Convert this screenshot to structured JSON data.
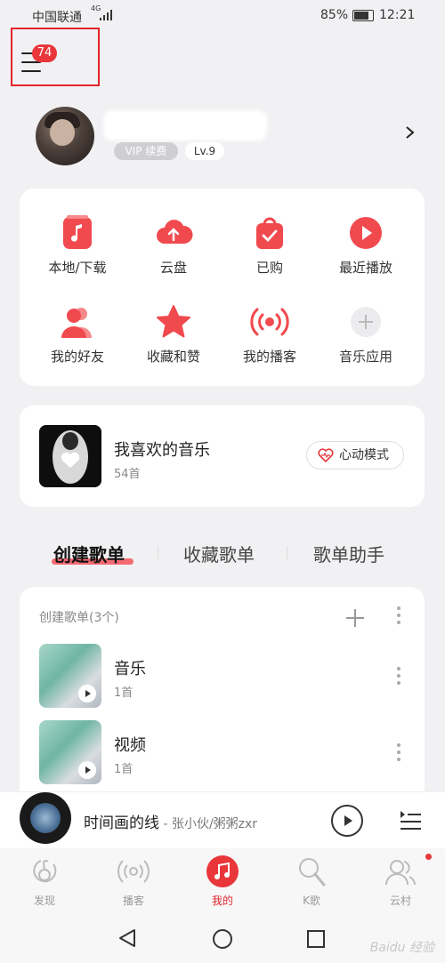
{
  "status_bar": {
    "carrier": "中国联通",
    "network": "4G",
    "battery_pct": "85%",
    "time": "12:21"
  },
  "menu": {
    "badge": "74"
  },
  "profile": {
    "vip_label": "VIP 续费",
    "level": "Lv.9"
  },
  "quick_grid": {
    "items": [
      {
        "label": "本地/下载",
        "icon": "music-note-icon"
      },
      {
        "label": "云盘",
        "icon": "cloud-upload-icon"
      },
      {
        "label": "已购",
        "icon": "shopping-bag-icon"
      },
      {
        "label": "最近播放",
        "icon": "play-circle-icon"
      },
      {
        "label": "我的好友",
        "icon": "friends-icon"
      },
      {
        "label": "收藏和赞",
        "icon": "star-icon"
      },
      {
        "label": "我的播客",
        "icon": "broadcast-icon"
      },
      {
        "label": "音乐应用",
        "icon": "plus-icon"
      }
    ]
  },
  "favorites": {
    "title": "我喜欢的音乐",
    "count": "54首",
    "heart_mode_label": "心动模式"
  },
  "tabs": [
    {
      "label": "创建歌单"
    },
    {
      "label": "收藏歌单"
    },
    {
      "label": "歌单助手"
    }
  ],
  "playlists": {
    "header": "创建歌单(3个)",
    "items": [
      {
        "name": "音乐",
        "count": "1首"
      },
      {
        "name": "视频",
        "count": "1首"
      }
    ]
  },
  "player": {
    "title": "时间画的线",
    "artist": " - 张小伙/粥粥zxr"
  },
  "bottom_nav": [
    {
      "label": "发现",
      "icon": "discover-icon"
    },
    {
      "label": "播客",
      "icon": "podcast-icon"
    },
    {
      "label": "我的",
      "icon": "my-music-icon"
    },
    {
      "label": "K歌",
      "icon": "karaoke-icon"
    },
    {
      "label": "云村",
      "icon": "community-icon"
    }
  ],
  "colors": {
    "accent": "#e8363a",
    "background": "#f1f1f3"
  },
  "watermark": "Baidu 经验"
}
